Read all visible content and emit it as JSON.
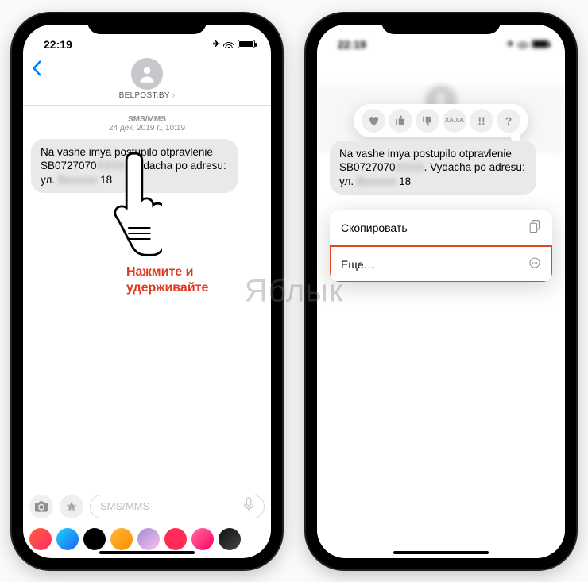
{
  "status": {
    "time": "22:19"
  },
  "left": {
    "sender": "BELPOST.BY",
    "thread_label": "SMS/MMS",
    "date": "24 дек. 2019 г., 10:19",
    "message_p1": "Na vashe imya postupilo otpravlenie SB0727070",
    "message_p2": ". Vydacha po adresu: ул.",
    "message_p3": " 18",
    "redact1": "XXXX",
    "redact2": "Bxxxxxx",
    "input_placeholder": "SMS/MMS",
    "instruction_l1": "Нажмите и",
    "instruction_l2": "удерживайте"
  },
  "right": {
    "message_p1": "Na vashe imya postupilo otpravlenie SB0727070",
    "message_p2": ". Vydacha po adresu: ул.",
    "message_p3": " 18",
    "redact1": "XXXX",
    "redact2": "Bxxxxxx",
    "tapback": {
      "haha": "XA XA",
      "bang": "!!",
      "q": "?"
    },
    "menu": {
      "copy": "Скопировать",
      "more": "Еще…"
    }
  },
  "watermark": "Яблык",
  "app_colors": [
    "#ff2d55",
    "#1e90ff",
    "#34c759",
    "#9b59b6",
    "#ff9500",
    "#ff2d55",
    "#ff2d55",
    "#000"
  ]
}
